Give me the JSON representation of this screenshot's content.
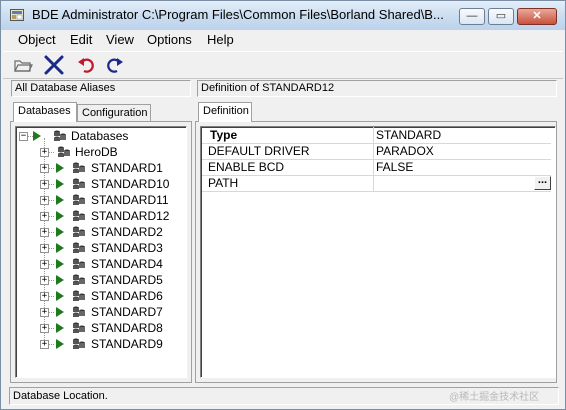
{
  "window": {
    "title": "BDE Administrator  C:\\Program Files\\Common Files\\Borland Shared\\B...",
    "buttons": {
      "minimize": "—",
      "maximize": "▭",
      "close": "✕"
    }
  },
  "menu": [
    "Object",
    "Edit",
    "View",
    "Options",
    "Help"
  ],
  "toolbar": {
    "icons": [
      "open-folder-icon",
      "delete-x-icon",
      "undo-icon",
      "redo-icon"
    ],
    "colors": {
      "delete": "#1b2a8a",
      "undo": "#c0182a",
      "redo": "#1b2a8a"
    }
  },
  "left_pane": {
    "header": "All Database Aliases",
    "tabs": [
      "Databases",
      "Configuration"
    ],
    "active_tab": "Databases",
    "tree": {
      "root": "Databases",
      "items": [
        "HeroDB",
        "STANDARD1",
        "STANDARD10",
        "STANDARD11",
        "STANDARD12",
        "STANDARD2",
        "STANDARD3",
        "STANDARD4",
        "STANDARD5",
        "STANDARD6",
        "STANDARD7",
        "STANDARD8",
        "STANDARD9"
      ]
    }
  },
  "right_pane": {
    "header": "Definition of STANDARD12",
    "tab": "Definition",
    "rows": [
      {
        "key": "Type",
        "value": "STANDARD"
      },
      {
        "key": "DEFAULT DRIVER",
        "value": "PARADOX"
      },
      {
        "key": "ENABLE BCD",
        "value": "FALSE"
      },
      {
        "key": "PATH",
        "value": ""
      }
    ],
    "ellipsis_label": "..."
  },
  "status": {
    "text": "Database Location."
  },
  "watermark": "@稀土掘金技术社区"
}
